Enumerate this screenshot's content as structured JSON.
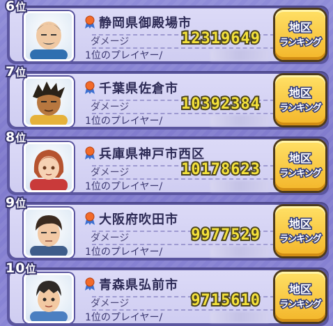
{
  "rows": [
    {
      "rank_num": "6",
      "rank_suffix": "位",
      "city": "静岡県御殿場市",
      "damage_label": "ダメージ",
      "damage": "12319649",
      "player_label": "1位のプレイヤー/",
      "button_l1": "地区",
      "button_l2": "ランキング",
      "avatar": "bald-man-with-mustache",
      "avatar_colors": {
        "skin": "#f0c9a3",
        "hair": "#6b6b6b",
        "shirt": "#2f6fb0"
      }
    },
    {
      "rank_num": "7",
      "rank_suffix": "位",
      "city": "千葉県佐倉市",
      "damage_label": "ダメージ",
      "damage": "10392384",
      "player_label": "1位のプレイヤー/",
      "button_l1": "地区",
      "button_l2": "ランキング",
      "avatar": "dark-spiky-hair-tan",
      "avatar_colors": {
        "skin": "#b7773f",
        "hair": "#2a2218",
        "shirt": "#e6b23a"
      }
    },
    {
      "rank_num": "8",
      "rank_suffix": "位",
      "city": "兵庫県神戸市西区",
      "damage_label": "ダメージ",
      "damage": "10178623",
      "player_label": "1位のプレイヤー/",
      "button_l1": "地区",
      "button_l2": "ランキング",
      "avatar": "girl-red-hair",
      "avatar_colors": {
        "skin": "#f6d2b4",
        "hair": "#b5532f",
        "shirt": "#c93a3a"
      }
    },
    {
      "rank_num": "9",
      "rank_suffix": "位",
      "city": "大阪府吹田市",
      "damage_label": "ダメージ",
      "damage": "9977529",
      "player_label": "1位のプレイヤー/",
      "button_l1": "地区",
      "button_l2": "ランキング",
      "avatar": "man-dark-hair-glasses",
      "avatar_colors": {
        "skin": "#f2c9a5",
        "hair": "#3a2a1f",
        "shirt": "#3e5d8a"
      }
    },
    {
      "rank_num": "10",
      "rank_suffix": "位",
      "city": "青森県弘前市",
      "damage_label": "ダメージ",
      "damage": "9715610",
      "player_label": "1位のプレイヤー/",
      "button_l1": "地区",
      "button_l2": "ランキング",
      "avatar": "boy-dark-hair",
      "avatar_colors": {
        "skin": "#f3c9a2",
        "hair": "#2f2a26",
        "shirt": "#4a7fc1"
      }
    }
  ]
}
